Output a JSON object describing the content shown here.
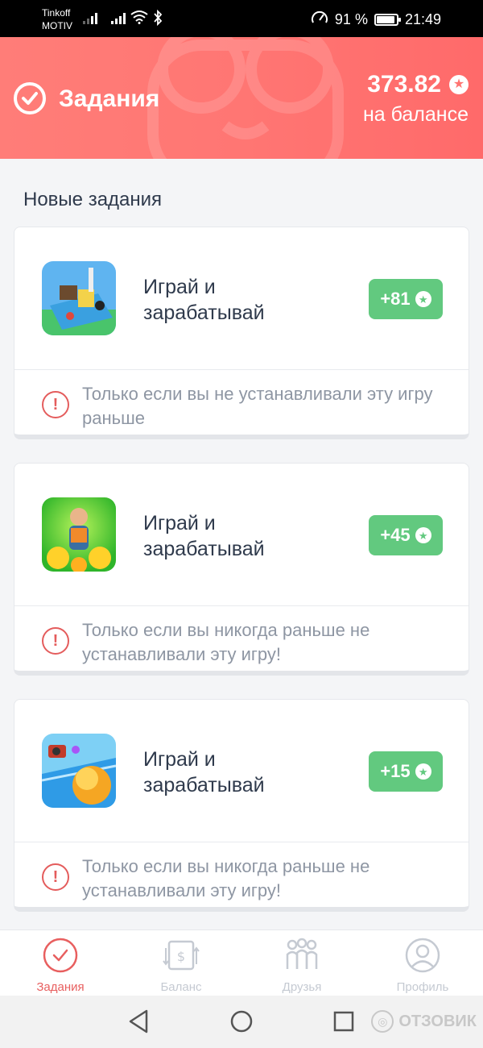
{
  "status_bar": {
    "carrier_top": "Tinkoff",
    "carrier_bottom": "MOTIV",
    "battery_percent": "91 %",
    "battery_level": 0.91,
    "time": "21:49"
  },
  "header": {
    "title": "Задания",
    "balance_amount": "373.82",
    "balance_label": "на балансе",
    "accent_color": "#ff7673"
  },
  "section_title": "Новые задания",
  "tasks": [
    {
      "title": "Играй и зарабатывай",
      "reward": "+81",
      "note": "Только если вы не устанавливали эту игру\nраньше",
      "icon": "game-boat-icon"
    },
    {
      "title": "Играй и зарабатывай",
      "reward": "+45",
      "note": "Только если вы никогда раньше не\nустанавливали эту игру!",
      "icon": "game-worker-icon"
    },
    {
      "title": "Играй и зарабатывай",
      "reward": "+15",
      "note": "Только если вы никогда раньше не\nустанавливали эту игру!",
      "icon": "game-ball-icon"
    }
  ],
  "nav": {
    "items": [
      {
        "label": "Задания",
        "icon": "check-circle-icon",
        "active": true
      },
      {
        "label": "Баланс",
        "icon": "wallet-transfer-icon",
        "active": false
      },
      {
        "label": "Друзья",
        "icon": "friends-icon",
        "active": false
      },
      {
        "label": "Профиль",
        "icon": "profile-icon",
        "active": false
      }
    ]
  },
  "watermark": "ОТЗОВИК"
}
